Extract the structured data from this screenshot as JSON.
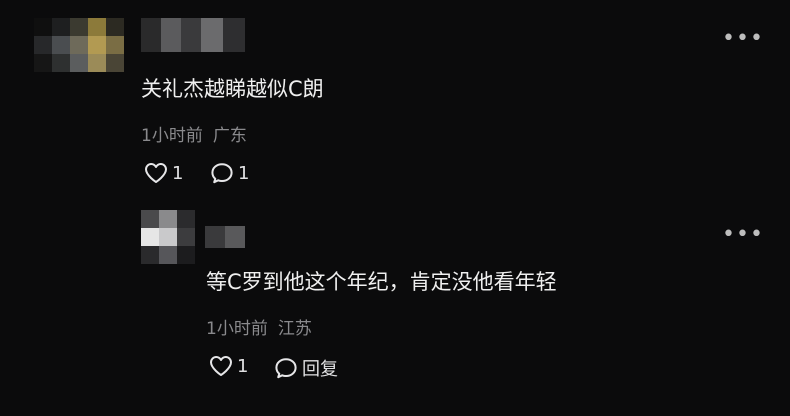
{
  "comments": [
    {
      "text": "关礼杰越睇越似C朗",
      "time": "1小时前",
      "location": "广东",
      "likes": "1",
      "replies": "1",
      "more_icon": "more-dots-icon"
    },
    {
      "text": "等C罗到他这个年纪，肯定没他看年轻",
      "time": "1小时前",
      "location": "江苏",
      "likes": "1",
      "reply_label": "回复",
      "more_icon": "more-dots-icon"
    }
  ],
  "icons": {
    "like": "heart-outline-icon",
    "reply": "speech-bubble-icon"
  }
}
